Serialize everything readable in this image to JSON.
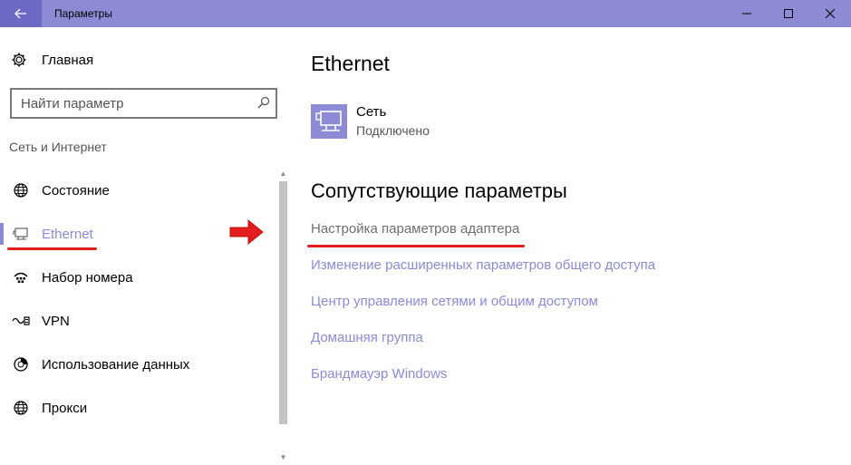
{
  "window": {
    "title": "Параметры"
  },
  "sidebar": {
    "home_label": "Главная",
    "search_placeholder": "Найти параметр",
    "section_label": "Сеть и Интернет",
    "items": [
      {
        "label": "Состояние",
        "icon": "globe-icon"
      },
      {
        "label": "Ethernet",
        "icon": "ethernet-icon",
        "active": true
      },
      {
        "label": "Набор номера",
        "icon": "dialup-icon"
      },
      {
        "label": "VPN",
        "icon": "vpn-icon"
      },
      {
        "label": "Использование данных",
        "icon": "data-usage-icon"
      },
      {
        "label": "Прокси",
        "icon": "globe-icon"
      }
    ]
  },
  "main": {
    "title": "Ethernet",
    "network": {
      "name": "Сеть",
      "status": "Подключено"
    },
    "related_title": "Сопутствующие параметры",
    "links": [
      "Настройка параметров адаптера",
      "Изменение расширенных параметров общего доступа",
      "Центр управления сетями и общим доступом",
      "Домашняя группа",
      "Брандмауэр Windows"
    ]
  },
  "colors": {
    "accent": "#8d8ad6",
    "titlebar_back": "#6c69c4",
    "annotation": "#e31d1d"
  }
}
